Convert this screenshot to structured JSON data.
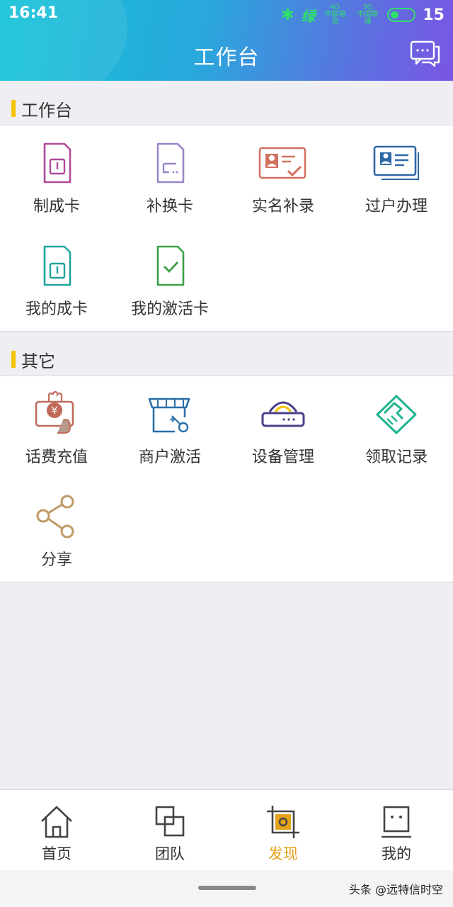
{
  "status_bar": {
    "time": "16:41",
    "carrier": "绿",
    "sig1_top": "4G",
    "sig1_bottom": "中国电信",
    "sig2_top": "3G",
    "sig2_bottom": "中国联通",
    "battery_text": "15",
    "battery_level": 0.15
  },
  "header": {
    "title": "工作台",
    "message_icon": "chat-bubble-icon"
  },
  "sections": [
    {
      "title": "工作台",
      "items": [
        {
          "label": "制成卡",
          "icon": "sim-card-icon",
          "color": "#b0489a"
        },
        {
          "label": "补换卡",
          "icon": "sim-card-swap-icon",
          "color": "#9a86c8"
        },
        {
          "label": "实名补录",
          "icon": "id-card-check-icon",
          "color": "#d2705f"
        },
        {
          "label": "过户办理",
          "icon": "id-card-transfer-icon",
          "color": "#2e67a6"
        },
        {
          "label": "我的成卡",
          "icon": "sim-card-icon",
          "color": "#1ea39b"
        },
        {
          "label": "我的激活卡",
          "icon": "sim-card-check-icon",
          "color": "#3aa046"
        }
      ]
    },
    {
      "title": "其它",
      "items": [
        {
          "label": "话费充值",
          "icon": "recharge-yuan-icon",
          "color": "#c06a5a"
        },
        {
          "label": "商户激活",
          "icon": "store-key-icon",
          "color": "#2a6fa8"
        },
        {
          "label": "设备管理",
          "icon": "router-device-icon",
          "color": "#4a3f8a"
        },
        {
          "label": "领取记录",
          "icon": "handshake-icon",
          "color": "#1eb58f"
        },
        {
          "label": "分享",
          "icon": "share-icon",
          "color": "#c09a66"
        }
      ]
    }
  ],
  "tabbar": {
    "tabs": [
      {
        "label": "首页",
        "icon": "home-icon",
        "active": false
      },
      {
        "label": "团队",
        "icon": "team-icon",
        "active": false
      },
      {
        "label": "发现",
        "icon": "discover-icon",
        "active": true
      },
      {
        "label": "我的",
        "icon": "profile-icon",
        "active": false
      }
    ],
    "active_color": "#e4a21a"
  },
  "watermark": "头条 @远特信时空"
}
